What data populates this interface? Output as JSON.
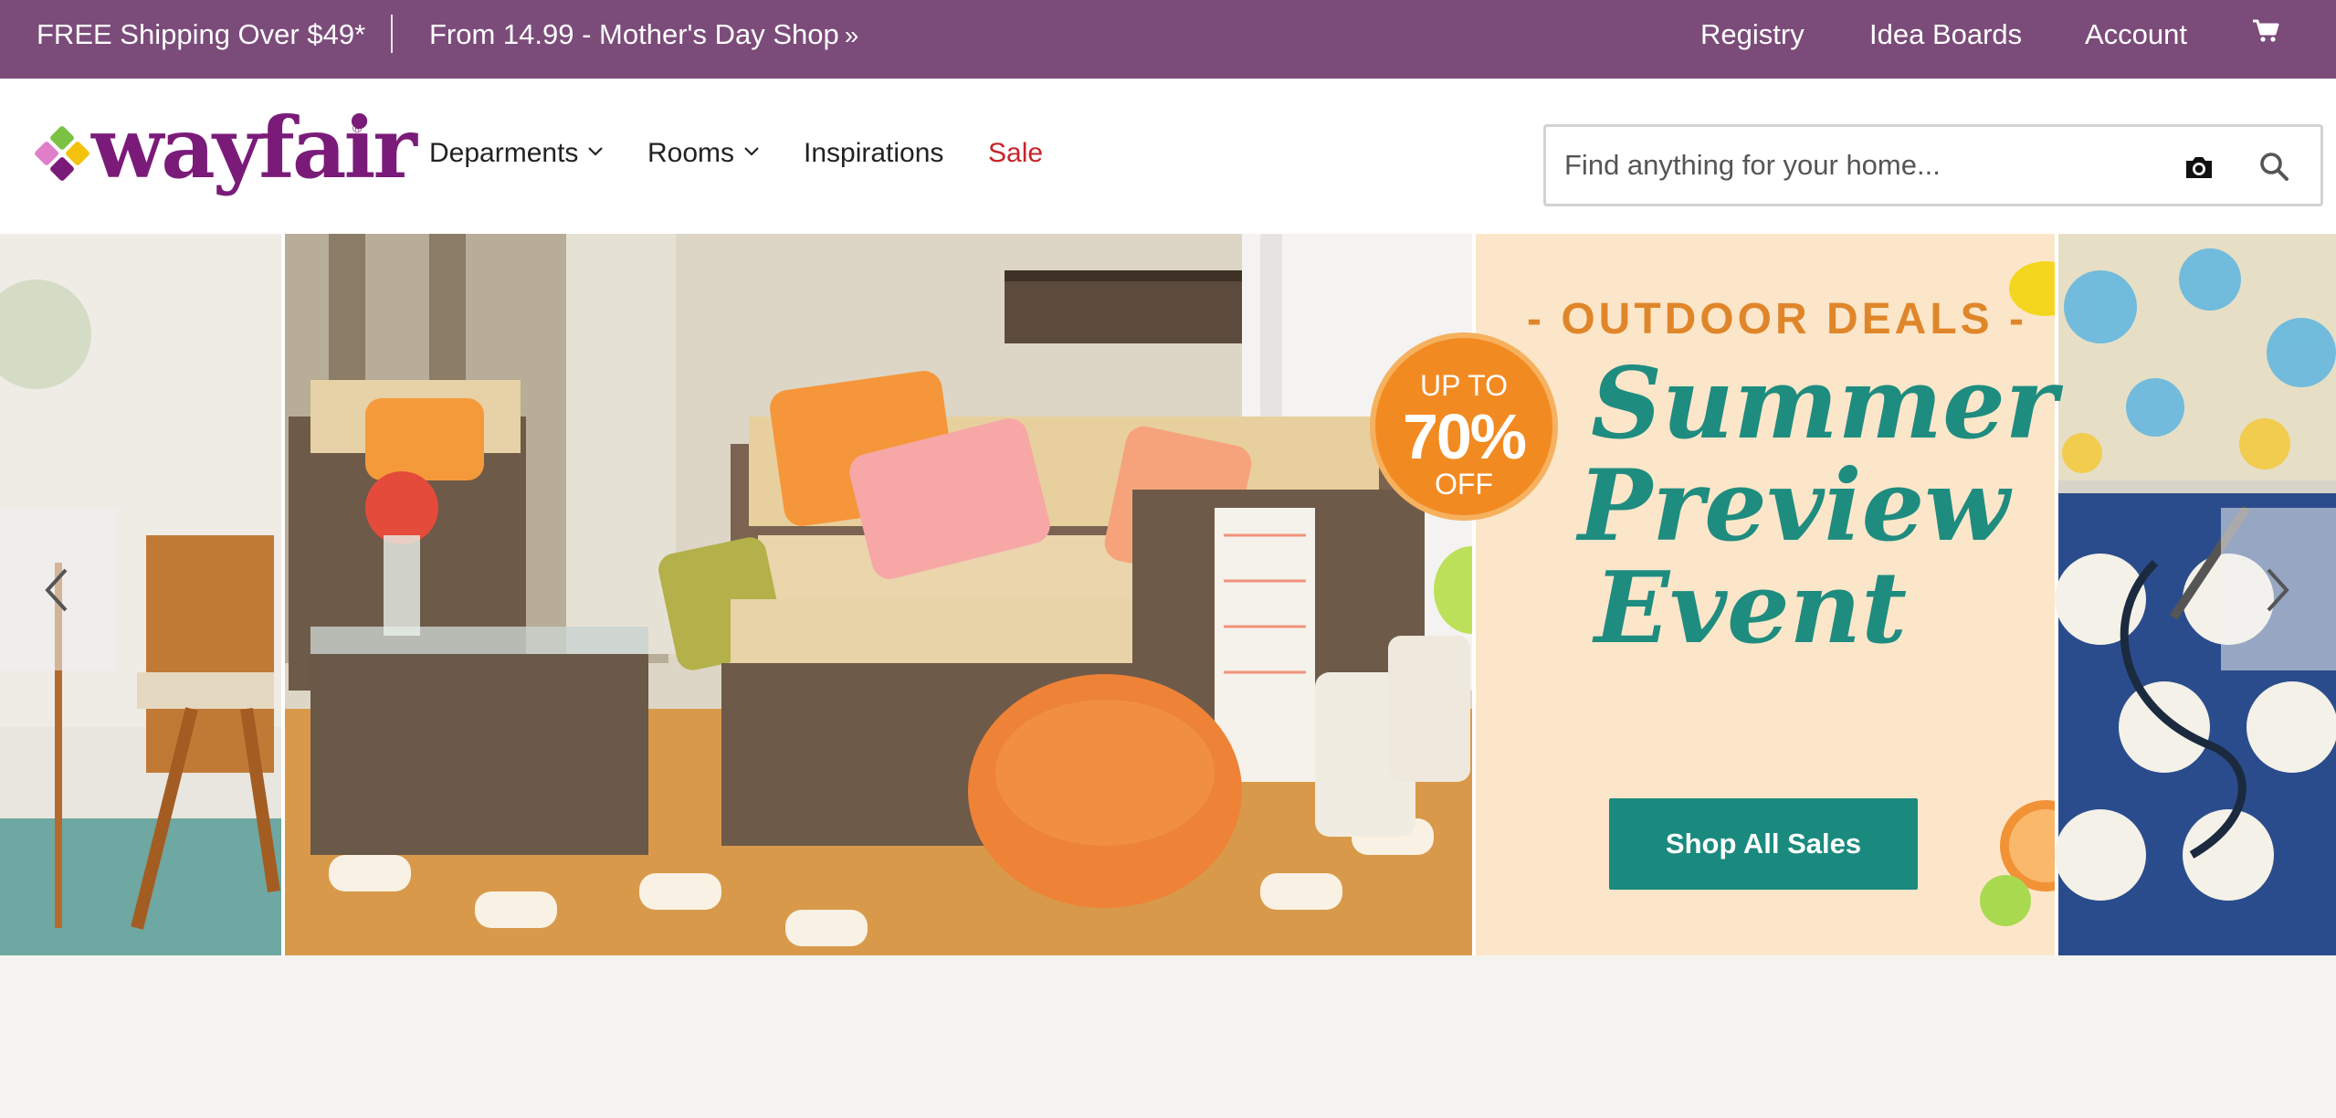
{
  "topbar": {
    "promo_shipping": "FREE Shipping Over $49*",
    "promo_mothers_day": "From 14.99 - Mother's Day Shop",
    "promo_chevron": "»",
    "registry": "Registry",
    "idea_boards": "Idea Boards",
    "account": "Account",
    "cart_icon": "cart-icon",
    "background_color": "#7b4b7a"
  },
  "header": {
    "logo_text": "wayfair",
    "nav": {
      "departments": "Deparments",
      "rooms": "Rooms",
      "inspirations": "Inspirations",
      "sale": "Sale"
    },
    "search": {
      "placeholder": "Find anything for your home...",
      "camera_icon": "camera-icon",
      "search_icon": "search-icon"
    },
    "brand_color": "#7b1b79",
    "sale_color": "#c8232c"
  },
  "hero": {
    "badge_line1": "UP TO",
    "badge_line2": "70%",
    "badge_line3": "OFF",
    "kicker": "- OUTDOOR DEALS -",
    "title_line1": "Summer",
    "title_line2": "Preview",
    "title_line3": "Event",
    "cta": "Shop All Sales",
    "cta_color": "#1a8a7e",
    "prev_icon": "chevron-left-icon",
    "next_icon": "chevron-right-icon"
  }
}
